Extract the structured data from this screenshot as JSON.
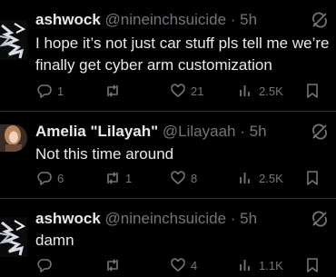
{
  "tweets": [
    {
      "name": "ashwock",
      "handle": "@nineinchsuicide",
      "time": "5h",
      "lines": [
        "I hope it’s not just car stuff pls tell me we’re",
        "finally get cyber arm customization"
      ],
      "replies": "1",
      "retweets": "",
      "likes": "21",
      "views": "2.5K"
    },
    {
      "name": "Amelia \"Lilayah\"",
      "handle": "@Lilayaah",
      "time": "5h",
      "lines": [
        "Not this time around"
      ],
      "replies": "6",
      "retweets": "1",
      "likes": "8",
      "views": "2.5K"
    },
    {
      "name": "ashwock",
      "handle": "@nineinchsuicide",
      "time": "5h",
      "lines": [
        "damn"
      ],
      "replies": "",
      "retweets": "",
      "likes": "4",
      "views": "1.1K"
    }
  ],
  "colors": {
    "text": "#e7e9ea",
    "muted": "#71767b",
    "background": "#000000",
    "separator": "#2f3336"
  },
  "icons": [
    "reply-icon",
    "retweet-icon",
    "like-icon",
    "views-icon",
    "bookmark-icon",
    "muted-conversation-icon"
  ]
}
